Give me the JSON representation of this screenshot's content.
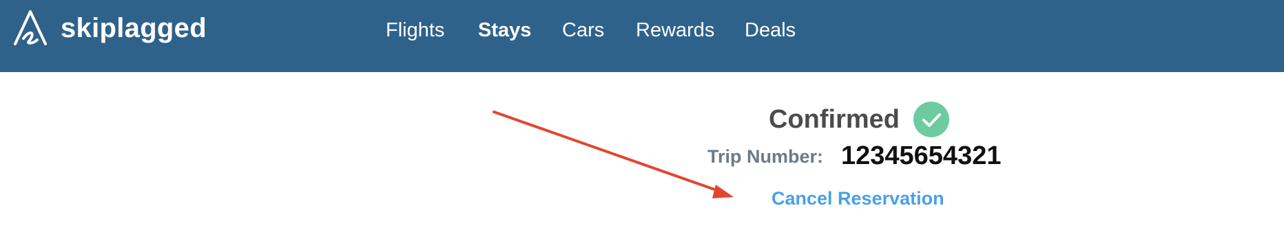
{
  "brand": {
    "name": "skiplagged",
    "header_color": "#2f628a"
  },
  "nav": {
    "items": [
      {
        "label": "Flights",
        "active": false
      },
      {
        "label": "Stays",
        "active": true
      },
      {
        "label": "Cars",
        "active": false
      },
      {
        "label": "Rewards",
        "active": false
      },
      {
        "label": "Deals",
        "active": false
      }
    ]
  },
  "confirmation": {
    "status": "Confirmed",
    "status_icon": "check-circle-icon",
    "status_color": "#6dcba0",
    "trip_label": "Trip Number:",
    "trip_number": "12345654321",
    "cancel_label": "Cancel Reservation",
    "link_color": "#4aa0e8"
  },
  "annotation": {
    "icon": "red-arrow-icon",
    "color": "#e2462f"
  }
}
